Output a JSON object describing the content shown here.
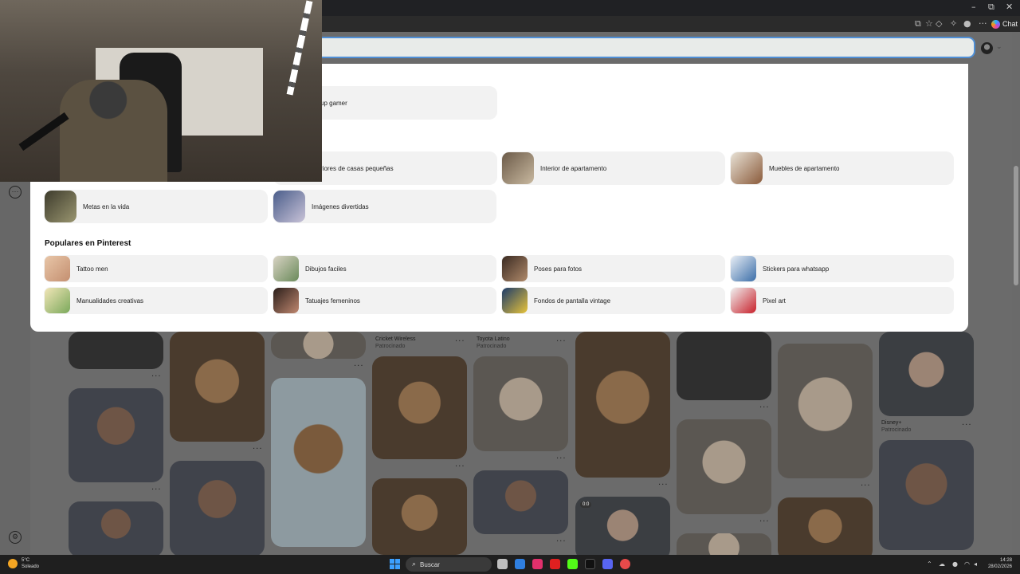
{
  "browser": {
    "minimize_glyph": "–",
    "maximize_glyph": "⧉",
    "close_glyph": "✕",
    "chat_label": "Chat"
  },
  "search": {
    "value": "",
    "placeholder": ""
  },
  "dropdown": {
    "recent_suggestions": [
      {
        "label": "up gamer"
      }
    ],
    "ideas": [
      {
        "label": "riores de casas pequeñas"
      },
      {
        "label": "Interior de apartamento"
      },
      {
        "label": "Muebles de apartamento"
      },
      {
        "label": "Metas en la vida"
      },
      {
        "label": "Imágenes divertidas"
      }
    ],
    "popular_title": "Populares en Pinterest",
    "popular": [
      {
        "label": "Tattoo men"
      },
      {
        "label": "Dibujos faciles"
      },
      {
        "label": "Poses para fotos"
      },
      {
        "label": "Stickers para whatsapp"
      },
      {
        "label": "Manualidades creativas"
      },
      {
        "label": "Tatuajes femeninos"
      },
      {
        "label": "Fondos de pantalla vintage"
      },
      {
        "label": "Pixel art"
      }
    ]
  },
  "feed": {
    "captions": [
      {
        "title": "Cricket Wireless",
        "sub": "Patrocinado"
      },
      {
        "title": "Toyota Latino",
        "sub": "Patrocinado"
      },
      {
        "title": "Disney+",
        "sub": "Patrocinado"
      }
    ],
    "more_glyph": "···",
    "video_badge": "0:0"
  },
  "taskbar": {
    "weather_temp": "5°C",
    "weather_desc": "Soleado",
    "search_label": "Buscar",
    "time": "14:28",
    "date": "28/02/2026"
  },
  "colors": {
    "search_focus": "#4f8fd6",
    "windows_blue": "#3ca0ff"
  }
}
